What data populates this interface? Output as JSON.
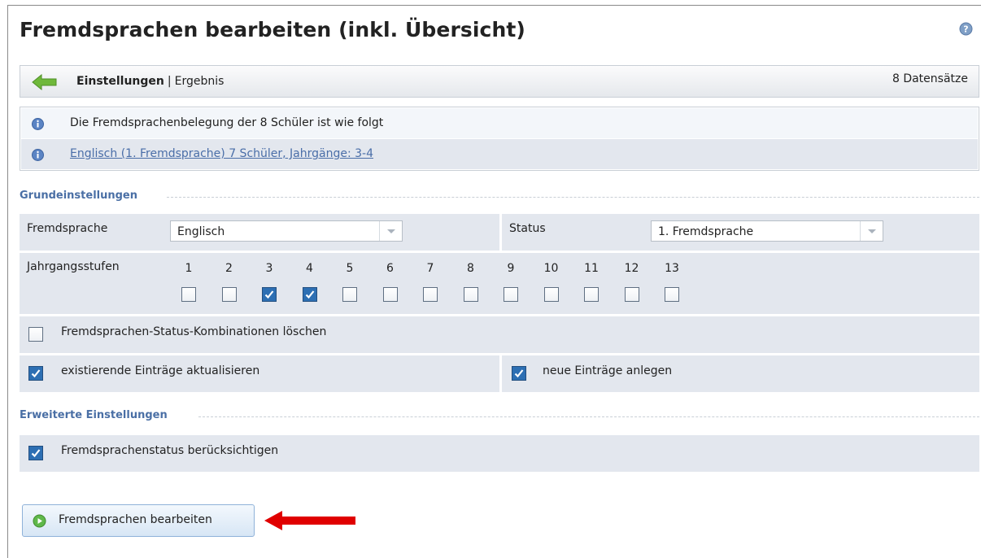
{
  "page": {
    "title": "Fremdsprachen bearbeiten (inkl. Übersicht)"
  },
  "toolbar": {
    "crumb_active": "Einstellungen",
    "separator": "|",
    "crumb_next": "Ergebnis",
    "records": "8 Datensätze"
  },
  "info": {
    "summary": "Die Fremdsprachenbelegung der 8 Schüler ist wie folgt",
    "link": "Englisch (1. Fremdsprache) 7 Schüler, Jahrgänge: 3-4"
  },
  "grund": {
    "heading": "Grundeinstellungen",
    "language_label": "Fremdsprache",
    "language_value": "Englisch",
    "status_label": "Status",
    "status_value": "1. Fremdsprache",
    "years_label": "Jahrgangsstufen",
    "years": [
      "1",
      "2",
      "3",
      "4",
      "5",
      "6",
      "7",
      "8",
      "9",
      "10",
      "11",
      "12",
      "13"
    ],
    "years_checked": [
      false,
      false,
      true,
      true,
      false,
      false,
      false,
      false,
      false,
      false,
      false,
      false,
      false
    ],
    "delete_label": "Fremdsprachen-Status-Kombinationen löschen",
    "delete_checked": false,
    "update_label": "existierende Einträge aktualisieren",
    "update_checked": true,
    "create_label": "neue Einträge anlegen",
    "create_checked": true
  },
  "erweitert": {
    "heading": "Erweiterte Einstellungen",
    "status_consider_label": "Fremdsprachenstatus berücksichtigen",
    "status_consider_checked": true
  },
  "action": {
    "button_label": "Fremdsprachen bearbeiten"
  },
  "colors": {
    "accent": "#4a6fa5",
    "row_bg": "#e3e7ee",
    "checkbox_checked": "#2d6fb3",
    "annotation_arrow": "#e00000"
  },
  "icons": {
    "help": "help-icon",
    "back": "back-arrow-icon",
    "info": "info-icon",
    "play": "play-icon",
    "annotation": "red-arrow-icon"
  }
}
